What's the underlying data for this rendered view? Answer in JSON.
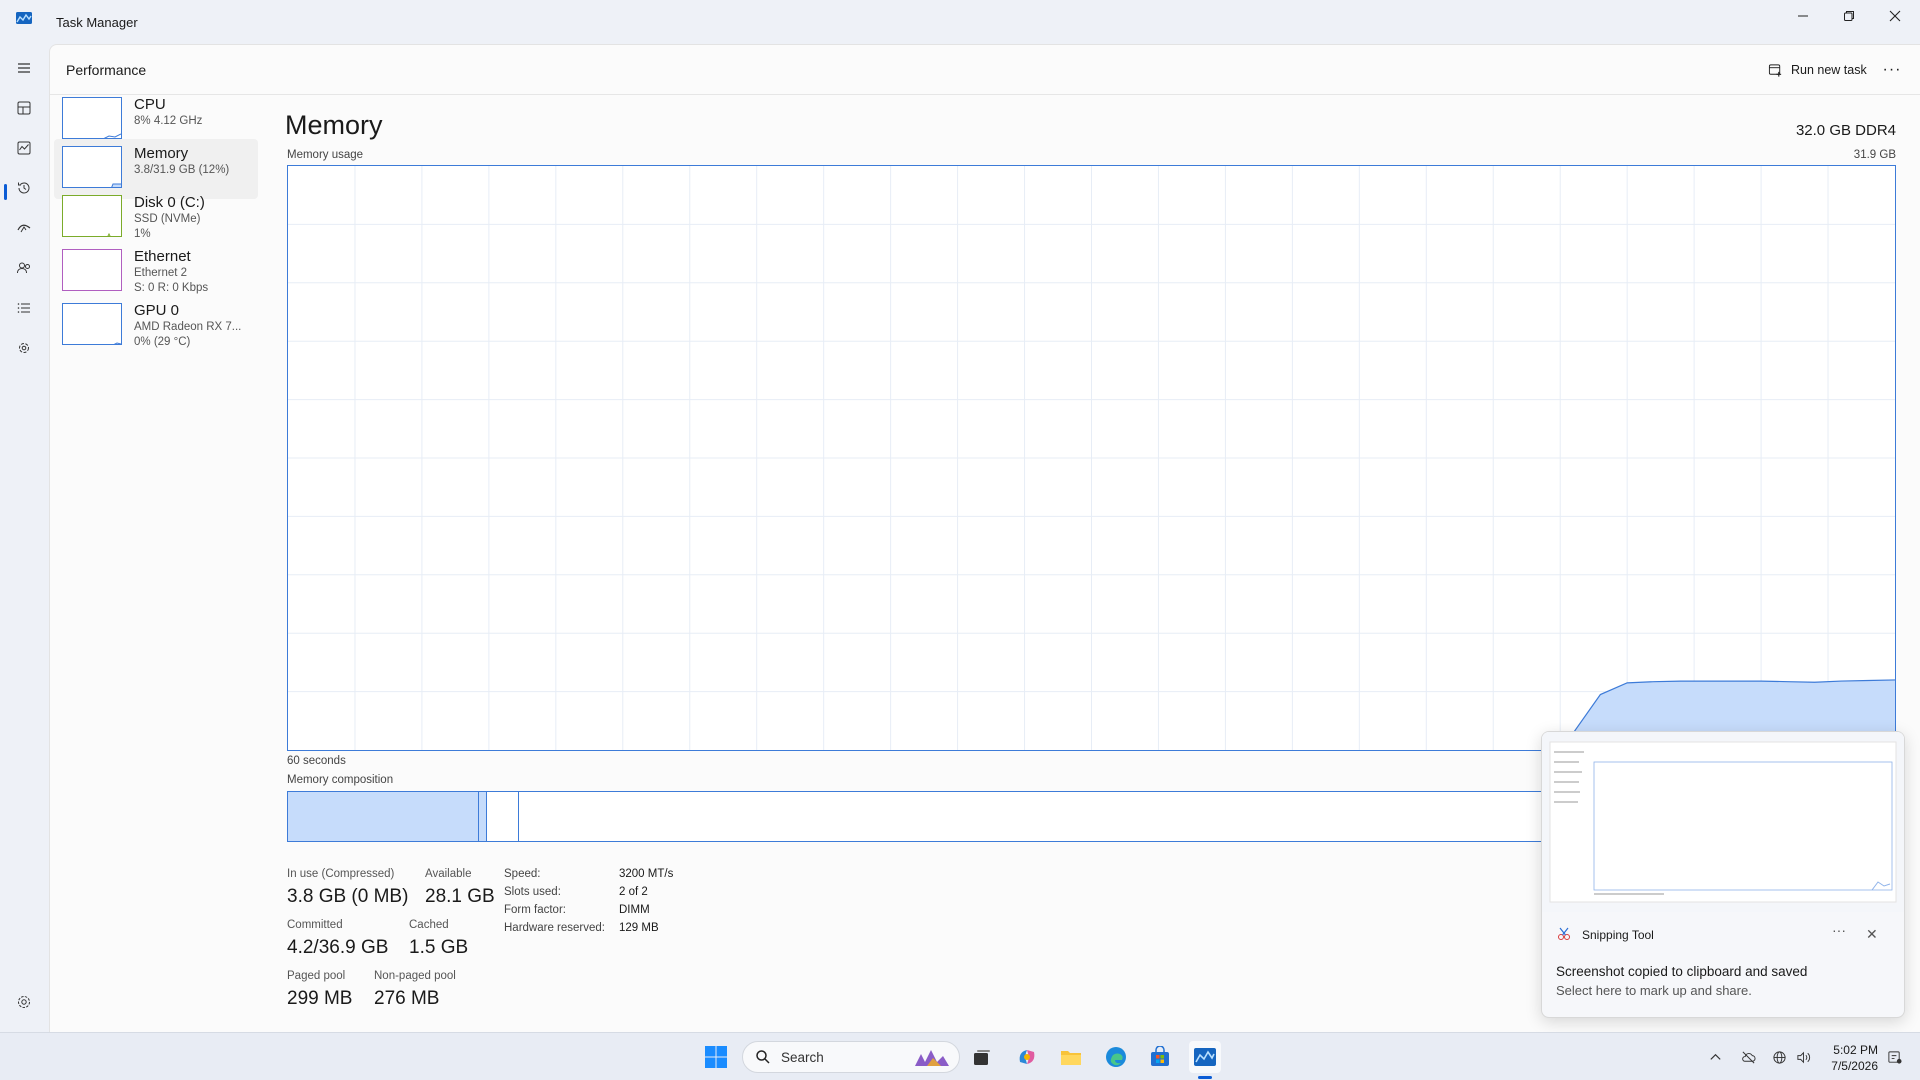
{
  "window": {
    "title": "Task Manager"
  },
  "header": {
    "title": "Performance",
    "run_new_task": "Run new task",
    "more": "···"
  },
  "devices": [
    {
      "name": "CPU",
      "line1": "8% 4.12 GHz",
      "line2": ""
    },
    {
      "name": "Memory",
      "line1": "3.8/31.9 GB (12%)",
      "line2": ""
    },
    {
      "name": "Disk 0 (C:)",
      "line1": "SSD (NVMe)",
      "line2": "1%"
    },
    {
      "name": "Ethernet",
      "line1": "Ethernet 2",
      "line2": "S: 0 R: 0 Kbps"
    },
    {
      "name": "GPU 0",
      "line1": "AMD Radeon RX 7...",
      "line2": "0% (29 °C)"
    }
  ],
  "detail": {
    "title": "Memory",
    "total": "32.0 GB DDR4",
    "usage_label": "Memory usage",
    "usage_max": "31.9 GB",
    "time_span": "60 seconds",
    "composition_label": "Memory composition",
    "usage_history_fraction": [
      0,
      0,
      0,
      0,
      0,
      0,
      0,
      0,
      0,
      0,
      0,
      0,
      0,
      0,
      0,
      0,
      0,
      0,
      0,
      0,
      0,
      0,
      0,
      0,
      0,
      0,
      0,
      0,
      0,
      0,
      0,
      0,
      0,
      0,
      0,
      0,
      0,
      0,
      0,
      0,
      0,
      0,
      0,
      0,
      0,
      0,
      0,
      0,
      0.03,
      0.095,
      0.115,
      0.117,
      0.118,
      0.118,
      0.118,
      0.118,
      0.117,
      0.116,
      0.118,
      0.119,
      0.12
    ],
    "composition": {
      "in_use_gb": 3.8,
      "modified_gb": 0.3,
      "standby_gb": 1.5,
      "total_gb": 31.9
    },
    "stats": {
      "in_use_label": "In use (Compressed)",
      "in_use": "3.8 GB (0 MB)",
      "available_label": "Available",
      "available": "28.1 GB",
      "committed_label": "Committed",
      "committed": "4.2/36.9 GB",
      "cached_label": "Cached",
      "cached": "1.5 GB",
      "paged_label": "Paged pool",
      "paged": "299 MB",
      "nonpaged_label": "Non-paged pool",
      "nonpaged": "276 MB"
    },
    "specs": [
      {
        "k": "Speed:",
        "v": "3200 MT/s"
      },
      {
        "k": "Slots used:",
        "v": "2 of 2"
      },
      {
        "k": "Form factor:",
        "v": "DIMM"
      },
      {
        "k": "Hardware reserved:",
        "v": "129 MB"
      }
    ]
  },
  "toast": {
    "app": "Snipping Tool",
    "title": "Screenshot copied to clipboard and saved",
    "body": "Select here to mark up and share."
  },
  "taskbar": {
    "search_placeholder": "Search",
    "time": "5:02 PM",
    "date": "7/5/2026"
  },
  "colors": {
    "accent": "#0b5cd5",
    "graph_line": "#3d7bd8",
    "graph_fill": "#c6dcfb"
  }
}
